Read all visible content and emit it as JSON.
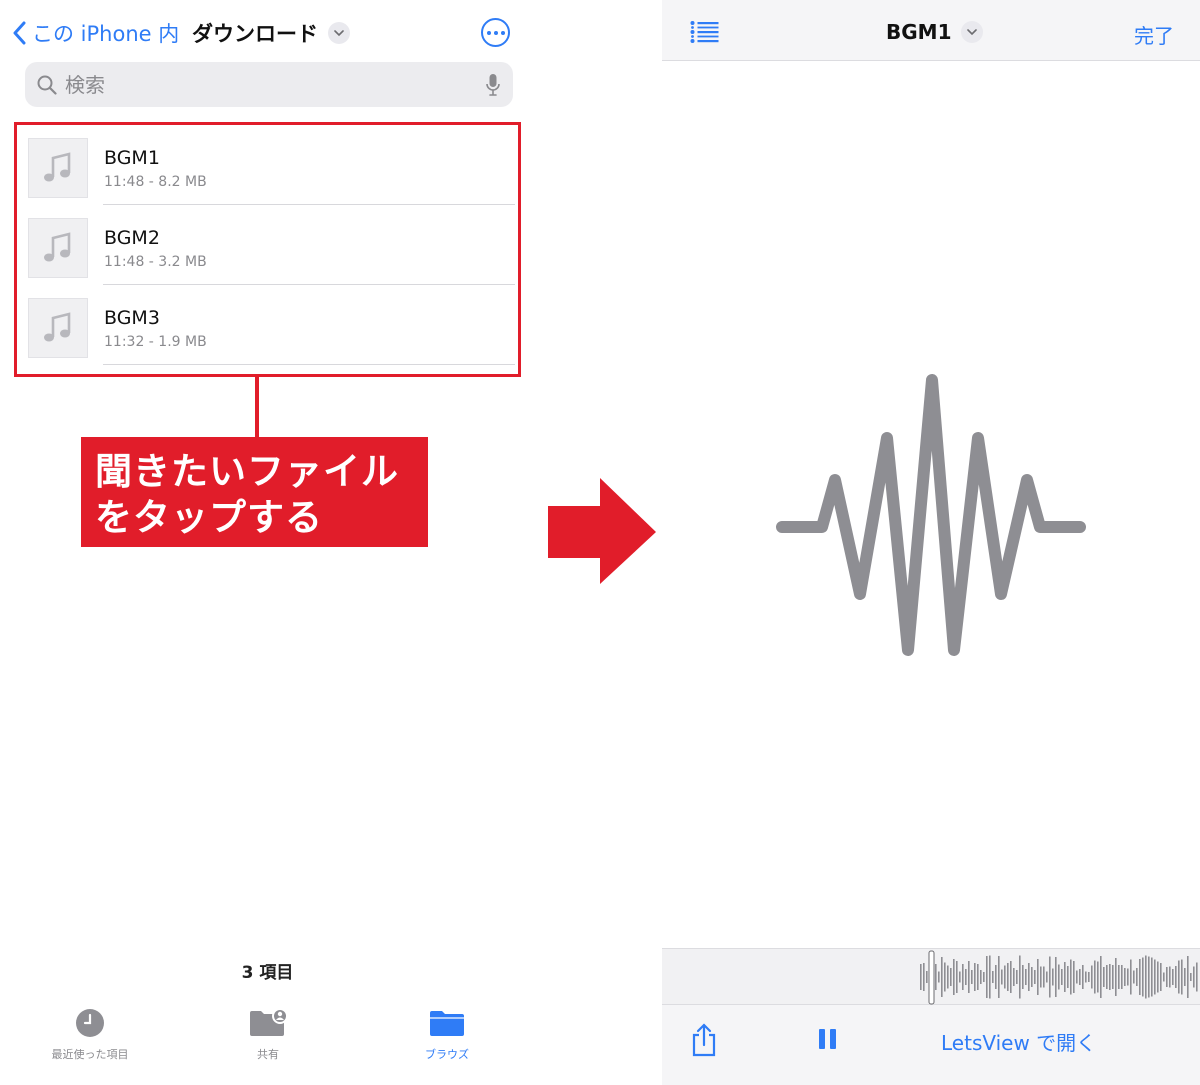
{
  "left": {
    "nav": {
      "back_label": "この iPhone 内",
      "title": "ダウンロード"
    },
    "search": {
      "placeholder": "検索"
    },
    "files": [
      {
        "name": "BGM1",
        "meta": "11:48 - 8.2 MB"
      },
      {
        "name": "BGM2",
        "meta": "11:48 - 3.2 MB"
      },
      {
        "name": "BGM3",
        "meta": "11:32 - 1.9 MB"
      }
    ],
    "callout": {
      "line1": "聞きたいファイル",
      "line2": "をタップする"
    },
    "count": "3 項目",
    "tabs": [
      {
        "label": "最近使った項目",
        "icon": "clock-icon"
      },
      {
        "label": "共有",
        "icon": "shared-folder-icon"
      },
      {
        "label": "ブラウズ",
        "icon": "folder-icon",
        "active": true
      }
    ]
  },
  "right": {
    "header": {
      "title": "BGM1",
      "done_label": "完了"
    },
    "toolbar": {
      "open_with_label": "LetsView で開く"
    }
  },
  "colors": {
    "accent": "#2f7cf6",
    "highlight": "#e11d2a",
    "waveform": "#8e8e93"
  }
}
